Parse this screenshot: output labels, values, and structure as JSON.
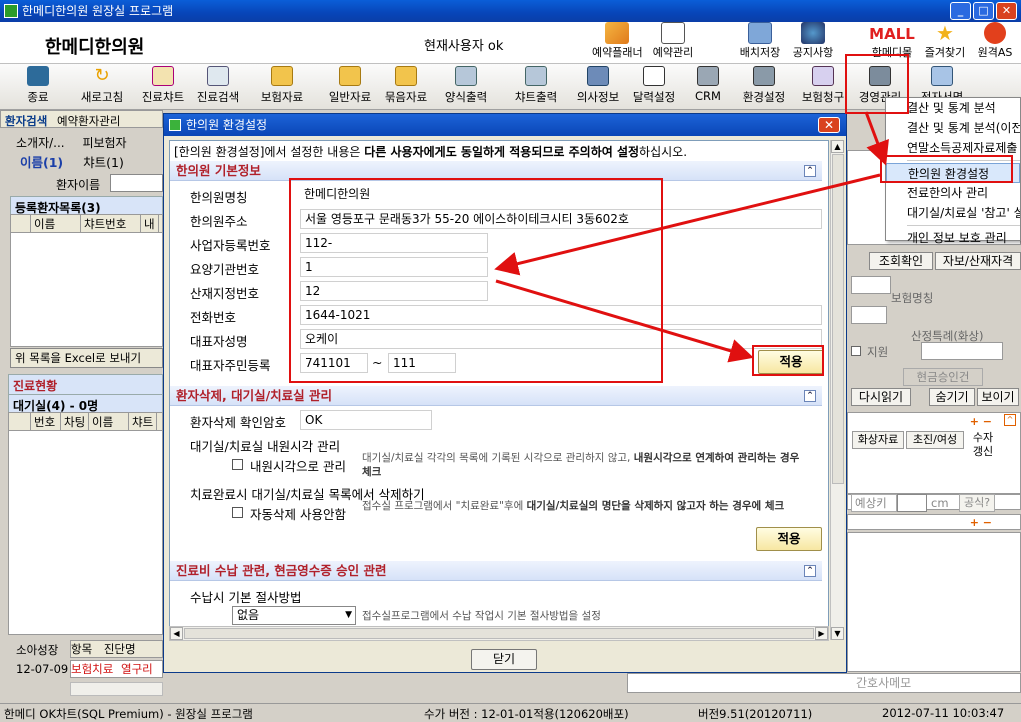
{
  "window": {
    "title": "한메디한의원 원장실 프로그램"
  },
  "header": {
    "clinic_name": "한메디한의원",
    "current_user": "현재사용자 ok",
    "top_buttons": [
      {
        "label": "예약플래너"
      },
      {
        "label": "예약관리"
      },
      {
        "label": "배치저장"
      },
      {
        "label": "공지사항"
      },
      {
        "label": "한메디몰"
      },
      {
        "label": "즐겨찾기"
      },
      {
        "label": "원격AS"
      }
    ],
    "mall_logo": "MALL"
  },
  "toolbar": {
    "items": [
      {
        "label": "종료",
        "icon": "exit-icon"
      },
      {
        "label": "새로고침",
        "icon": "refresh-icon"
      },
      {
        "label": "진료챠트",
        "icon": "chart-icon"
      },
      {
        "label": "진료검색",
        "icon": "search-icon"
      },
      {
        "label": "보험자료",
        "icon": "folder-icon"
      },
      {
        "label": "일반자료",
        "icon": "folder-icon"
      },
      {
        "label": "묶음자료",
        "icon": "folder-icon"
      },
      {
        "label": "양식출력",
        "icon": "printer-icon"
      },
      {
        "label": "챠트출력",
        "icon": "printer-icon"
      },
      {
        "label": "의사정보",
        "icon": "doctor-icon"
      },
      {
        "label": "달력설정",
        "icon": "calendar-icon"
      },
      {
        "label": "CRM",
        "icon": "crm-icon"
      },
      {
        "label": "환경설정",
        "icon": "settings-icon"
      },
      {
        "label": "보험청구",
        "icon": "claim-icon"
      },
      {
        "label": "경영관리",
        "icon": "management-icon"
      },
      {
        "label": "전자서명",
        "icon": "sign-icon"
      }
    ]
  },
  "left_panel": {
    "tabs": [
      "환자검색",
      "예약환자관리"
    ],
    "subtabs": [
      "소개자/...",
      "피보험자"
    ],
    "subtabs2": [
      "이름(1)",
      "챠트(1)"
    ],
    "search_label": "환자이름",
    "registered_title": "등록환자목록(3)",
    "registered_columns": [
      "이름",
      "챠트번호",
      "내"
    ],
    "excel_button": "위 목록을 Excel로 보내기",
    "status_title": "진료현황",
    "waiting_title": "대기실(4) - 0명",
    "waiting_columns": [
      "번호",
      "차팅",
      "이름",
      "챠트"
    ],
    "bottom_labels": [
      "소아성장",
      "항목",
      "진단명"
    ],
    "bottom_date": "12-07-09",
    "bottom_red": [
      "보험치료",
      "열구리"
    ]
  },
  "context_menu": {
    "items": [
      {
        "label": "결산 및 통계 분석"
      },
      {
        "label": "결산 및 통계 분석(이전)"
      },
      {
        "label": "연말소득공제자료제출"
      },
      {
        "label": "한의원 환경설정",
        "highlighted": true
      },
      {
        "label": "전료한의사 관리"
      },
      {
        "label": "대기실/치료실 '참고' 설정"
      },
      {
        "label": "개인 정보 보호 관리"
      }
    ]
  },
  "right_panel": {
    "buttons": [
      "조회확인",
      "자보/산재자격"
    ],
    "label_insurance": "보험명칭",
    "label_special": "산정특례(화상)",
    "label_support": "지원",
    "label_cash": "현금승인건",
    "buttons2": [
      "다시읽기",
      "숨기기",
      "보이기"
    ],
    "grid_cols": [
      "화상자료",
      "초진/여성",
      "수자갱신"
    ],
    "input_pred": "예상키",
    "unit_cm": "cm",
    "btn_formula": "공식?",
    "memo_placeholder": "간호사메모"
  },
  "dialog": {
    "title": "한의원 환경설정",
    "notice_prefix": "[한의원 환경설정]에서 설정한 내용은 ",
    "notice_bold": "다른 사용자에게도 동일하게 적용되므로 주의하여 설정",
    "notice_suffix": "하십시오.",
    "section1": {
      "title": "한의원 기본정보",
      "fields": [
        {
          "label": "한의원명칭",
          "value": "한메디한의원"
        },
        {
          "label": "한의원주소",
          "value": "서울 영등포구 문래동3가 55-20 에이스하이테크시티 3동602호"
        },
        {
          "label": "사업자등록번호",
          "value": "112-"
        },
        {
          "label": "요양기관번호",
          "value": "1"
        },
        {
          "label": "산재지정번호",
          "value": "12"
        },
        {
          "label": "전화번호",
          "value": "1644-1021"
        },
        {
          "label": "대표자성명",
          "value": "오케이"
        },
        {
          "label": "대표자주민등록",
          "value": "741101",
          "value2": "111",
          "sep": "~"
        }
      ],
      "apply_button": "적용"
    },
    "section2": {
      "title": "환자삭제, 대기실/치료실 관리",
      "confirm_pw_label": "환자삭제 확인암호",
      "confirm_pw_value": "OK",
      "visit_time_title": "대기실/치료실 내원시각 관리",
      "visit_time_checkbox": "내원시각으로 관리",
      "visit_time_desc_1": "대기실/치료실 각각의 목록에 기록된 시각으로 관리하지 않고, ",
      "visit_time_desc_bold": "내원시각으로 연계하여 관리하는 경우 체크",
      "delete_title": "치료완료시 대기실/치료실 목록에서 삭제하기",
      "delete_checkbox": "자동삭제 사용안함",
      "delete_desc_1": "접수실 프로그램에서 \"치료완료\"후에 ",
      "delete_desc_bold": "대기실/치료실의 명단을 삭제하지 않고자 하는 경우에 체크",
      "apply_button": "적용"
    },
    "section3": {
      "title": "진료비 수납 관련, 현금영수증 승인 관련",
      "payment_label": "수납시 기본 절사방법",
      "payment_value": "없음",
      "payment_desc": "접수실프로그램에서 수납 작업시 기본 절사방법을 설정"
    },
    "close_button": "닫기"
  },
  "statusbar": {
    "app": "한메디 OK차트(SQL Premium) - 원장실 프로그램",
    "fee_version": "수가 버전 : 12-01-01적용(120620배포)",
    "version": "버전9.51(20120711)",
    "datetime": "2012-07-11 10:03:47"
  },
  "colors": {
    "highlight_red": "#e01010",
    "section_title": "#b0202a",
    "titlebar_blue": "#0a46b6"
  }
}
